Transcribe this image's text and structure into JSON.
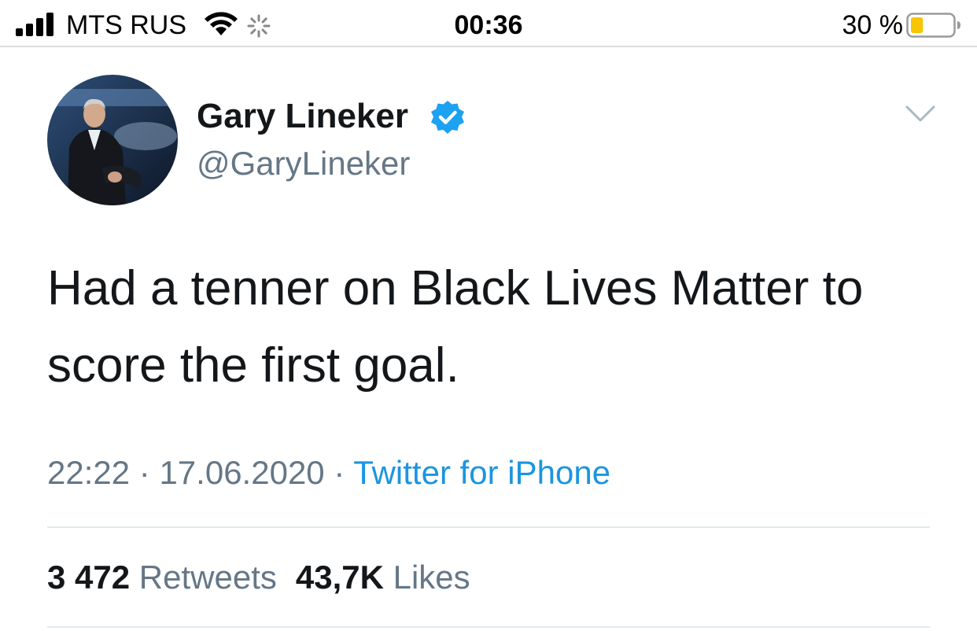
{
  "status_bar": {
    "carrier": "MTS RUS",
    "time": "00:36",
    "battery_percent": "30 %",
    "battery_level": 0.3,
    "icons": [
      "cellular-signal-icon",
      "wifi-icon",
      "activity-spinner-icon",
      "battery-icon"
    ]
  },
  "tweet": {
    "author": {
      "display_name": "Gary Lineker",
      "handle": "@GaryLineker",
      "verified": true
    },
    "text": "Had a tenner on Black Lives Matter to score the first goal.",
    "meta": {
      "time": "22:22",
      "separator": "·",
      "date": "17.06.2020",
      "source": "Twitter for iPhone"
    },
    "stats": {
      "retweets_count": "3 472",
      "retweets_label": "Retweets",
      "likes_count": "43,7K",
      "likes_label": "Likes"
    }
  },
  "colors": {
    "text_primary": "#14171a",
    "text_secondary": "#657786",
    "link_blue": "#1b95e0",
    "verified_blue": "#1da1f2",
    "battery_yellow": "#f7c600",
    "divider": "#e1e8ed"
  }
}
